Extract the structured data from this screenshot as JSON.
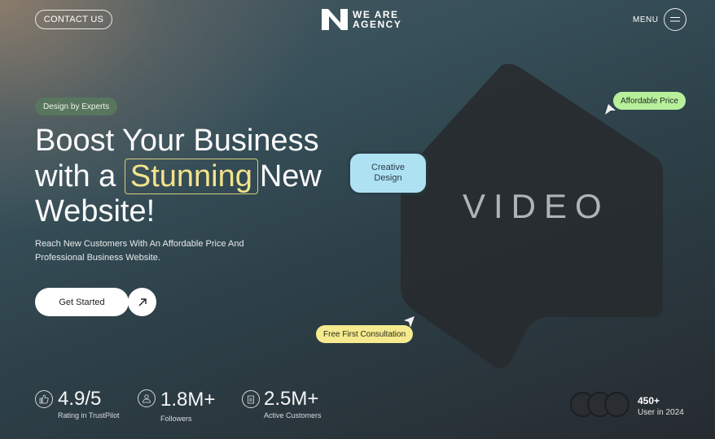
{
  "header": {
    "contact_label": "CONTACT US",
    "logo_line1": "WE ARE",
    "logo_line2": "AGENCY",
    "menu_label": "MENU"
  },
  "hero": {
    "tag": "Design by Experts",
    "headline_line1": "Boost Your Business",
    "headline_prefix": "with a",
    "headline_highlight": "Stunning",
    "headline_suffix": "New",
    "headline_line3": "Website!",
    "subtext_line1": "Reach New Customers With An Affordable Price And",
    "subtext_line2": "Professional Business Website.",
    "cta_label": "Get Started"
  },
  "media": {
    "video_label": "VIDEO",
    "creative_line1": "Creative",
    "creative_line2": "Design",
    "price_label": "Affordable Price",
    "consult_label": "Free First Consultation"
  },
  "stats": [
    {
      "value": "4.9/5",
      "label": "Rating in TrustPilot",
      "icon": "thumbs-up-icon"
    },
    {
      "value": "1.8M+",
      "label": "Followers",
      "icon": "users-icon"
    },
    {
      "value": "2.5M+",
      "label": "Active Customers",
      "icon": "building-icon"
    }
  ],
  "users": {
    "count": "450+",
    "label": "User in 2024"
  },
  "colors": {
    "tag_bg": "#58765e",
    "highlight": "#f3e48c",
    "creative_bg": "#aee2f3",
    "price_bg": "#b7ef9b",
    "consult_bg": "#f5ea8e"
  }
}
